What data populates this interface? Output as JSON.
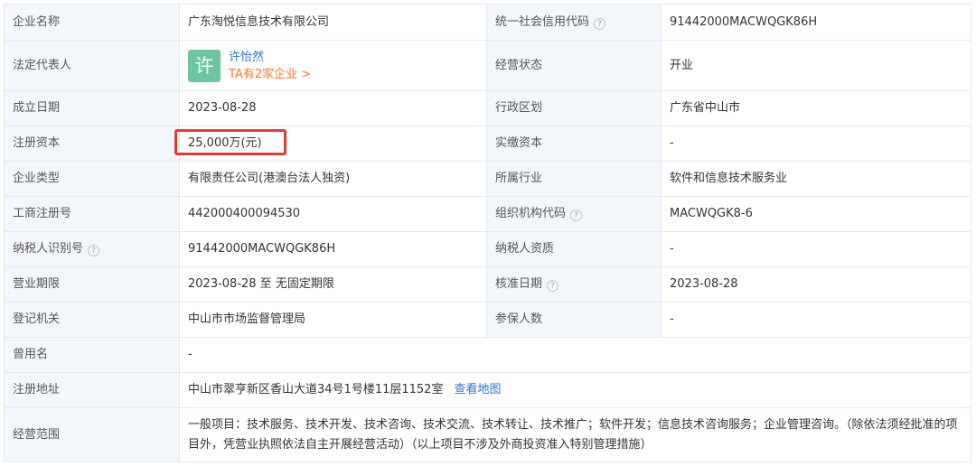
{
  "rows": [
    {
      "k1": "企业名称",
      "v1": "广东淘悦信息技术有限公司",
      "k2": "统一社会信用代码",
      "v2": "91442000MACWQGK86H"
    },
    {
      "k1": "法定代表人",
      "rep": {
        "avatar_char": "许",
        "name": "许怡然",
        "link": "TA有2家企业 >"
      },
      "k2": "经营状态",
      "v2": "开业"
    },
    {
      "k1": "成立日期",
      "v1": "2023-08-28",
      "k2": "行政区划",
      "v2": "广东省中山市"
    },
    {
      "k1": "注册资本",
      "v1": "25,000万(元)",
      "k2": "实缴资本",
      "v2": "-"
    },
    {
      "k1": "企业类型",
      "v1": "有限责任公司(港澳台法人独资)",
      "k2": "所属行业",
      "v2": "软件和信息技术服务业"
    },
    {
      "k1": "工商注册号",
      "v1": "442000400094530",
      "k2": "组织机构代码",
      "v2": "MACWQGK8-6"
    },
    {
      "k1": "纳税人识别号",
      "v1": "91442000MACWQGK86H",
      "k2": "纳税人资质",
      "v2": "-"
    },
    {
      "k1": "营业期限",
      "v1": "2023-08-28 至 无固定期限",
      "k2": "核准日期",
      "v2": "2023-08-28"
    },
    {
      "k1": "登记机关",
      "v1": "中山市市场监督管理局",
      "k2": "参保人数",
      "v2": "-"
    },
    {
      "k1": "曾用名",
      "v1": "-"
    },
    {
      "k1": "注册地址",
      "v1": "中山市翠亨新区香山大道34号1号楼11层1152室",
      "map_link": "查看地图"
    },
    {
      "k1": "经营范围",
      "v1": "一般项目：技术服务、技术开发、技术咨询、技术交流、技术转让、技术推广；软件开发；信息技术咨询服务；企业管理咨询。（除依法须经批准的项目外，凭营业执照依法自主开展经营活动）（以上项目不涉及外商投资准入特别管理措施）"
    }
  ],
  "help_glyph": "?",
  "colors": {
    "label_bg": "#f3f6fa",
    "border": "#e4e8ee",
    "link_blue": "#2d74c9",
    "link_orange": "#f07b2e",
    "avatar_green": "#6dc6a0",
    "highlight_red": "#e53935"
  }
}
